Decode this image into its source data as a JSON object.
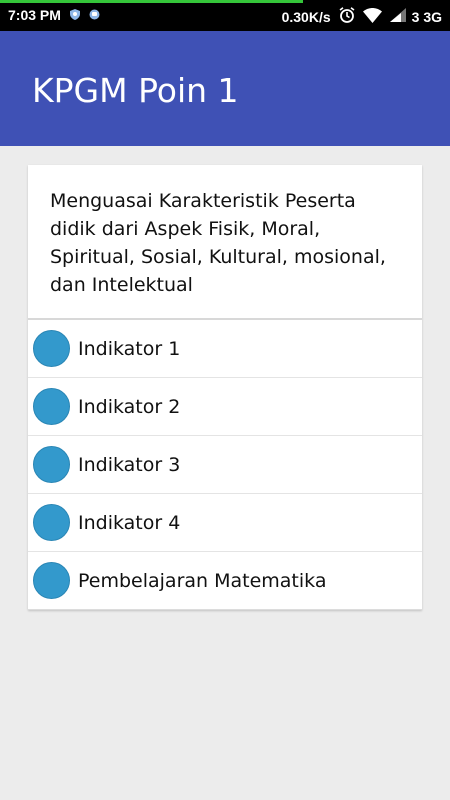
{
  "status_bar": {
    "time": "7:03 PM",
    "speed": "0.30K/s",
    "network": "3 3G",
    "icons": [
      "shield-icon",
      "notification-icon",
      "alarm-clock-icon",
      "wifi-icon",
      "signal-icon"
    ]
  },
  "app_bar": {
    "title": "KPGM Poin 1",
    "color": "#3f51b5"
  },
  "card": {
    "description": "Menguasai Karakteristik Peserta didik dari Aspek Fisik, Moral, Spiritual, Sosial, Kultural, mosional, dan Intelektual",
    "items": [
      {
        "label": "Indikator 1"
      },
      {
        "label": "Indikator 2"
      },
      {
        "label": "Indikator 3"
      },
      {
        "label": "Indikator 4"
      },
      {
        "label": "Pembelajaran Matematika"
      }
    ],
    "dot_color": "#3399cc"
  }
}
